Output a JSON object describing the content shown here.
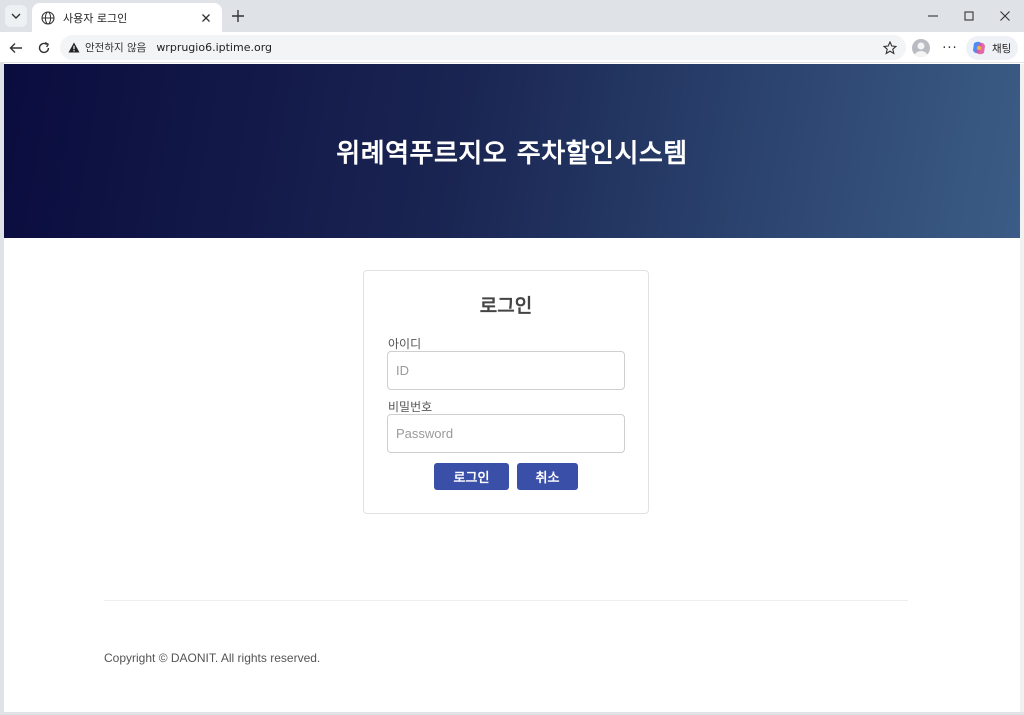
{
  "browser": {
    "tab_title": "사용자 로그인",
    "security_label": "안전하지 않음",
    "url": "wrprugio6.iptime.org",
    "copilot_label": "채팅"
  },
  "page": {
    "header_title": "위례역푸르지오 주차할인시스템",
    "login": {
      "heading": "로그인",
      "id_label": "아이디",
      "id_placeholder": "ID",
      "id_value": "",
      "password_label": "비밀번호",
      "password_placeholder": "Password",
      "password_value": "",
      "login_button": "로그인",
      "cancel_button": "취소"
    },
    "footer": {
      "copyright": "Copyright © DAONIT. All rights reserved."
    }
  },
  "colors": {
    "header_gradient_start": "#0a0c3e",
    "header_gradient_end": "#3b5c86",
    "button": "#3a4fa8"
  },
  "icons": [
    "tab-list-icon",
    "globe-icon",
    "close-icon",
    "plus-icon",
    "minimize-icon",
    "maximize-icon",
    "window-close-icon",
    "back-icon",
    "reload-icon",
    "warning-icon",
    "star-icon",
    "avatar-icon",
    "more-icon",
    "copilot-icon"
  ]
}
